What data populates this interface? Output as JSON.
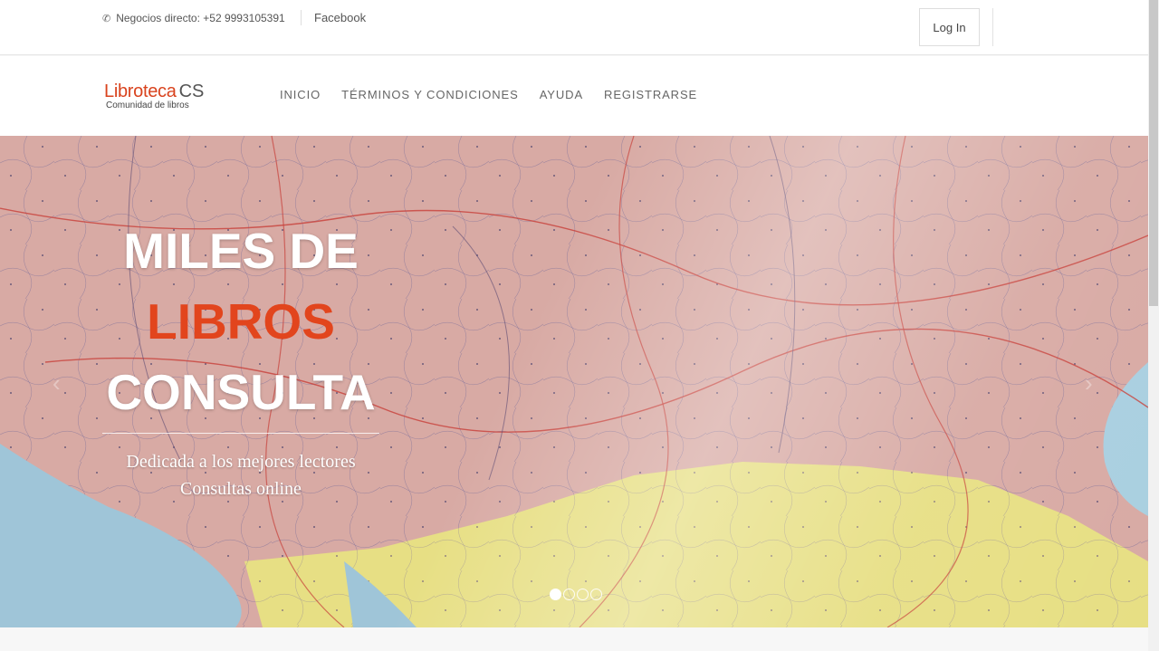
{
  "topbar": {
    "contact_text": "Negocios directo: +52 9993105391",
    "facebook_label": "Facebook",
    "login_label": "Log In"
  },
  "brand": {
    "name_part1": "Libroteca",
    "name_part2": "CS",
    "tagline": "Comunidad de libros"
  },
  "nav": {
    "items": [
      {
        "label": "INICIO"
      },
      {
        "label": "TÉRMINOS Y CONDICIONES"
      },
      {
        "label": "AYUDA"
      },
      {
        "label": "REGISTRARSE"
      }
    ]
  },
  "hero": {
    "line1": "MILES DE",
    "line2": "LIBROS",
    "line3": "CONSULTA",
    "desc1": "Dedicada a los mejores lectores",
    "desc2": "Consultas online",
    "prev_icon": "chevron-left-icon",
    "next_icon": "chevron-right-icon",
    "slide_count": 4,
    "active_slide": 1
  },
  "colors": {
    "accent": "#e2451d",
    "brand": "#d9431e"
  }
}
